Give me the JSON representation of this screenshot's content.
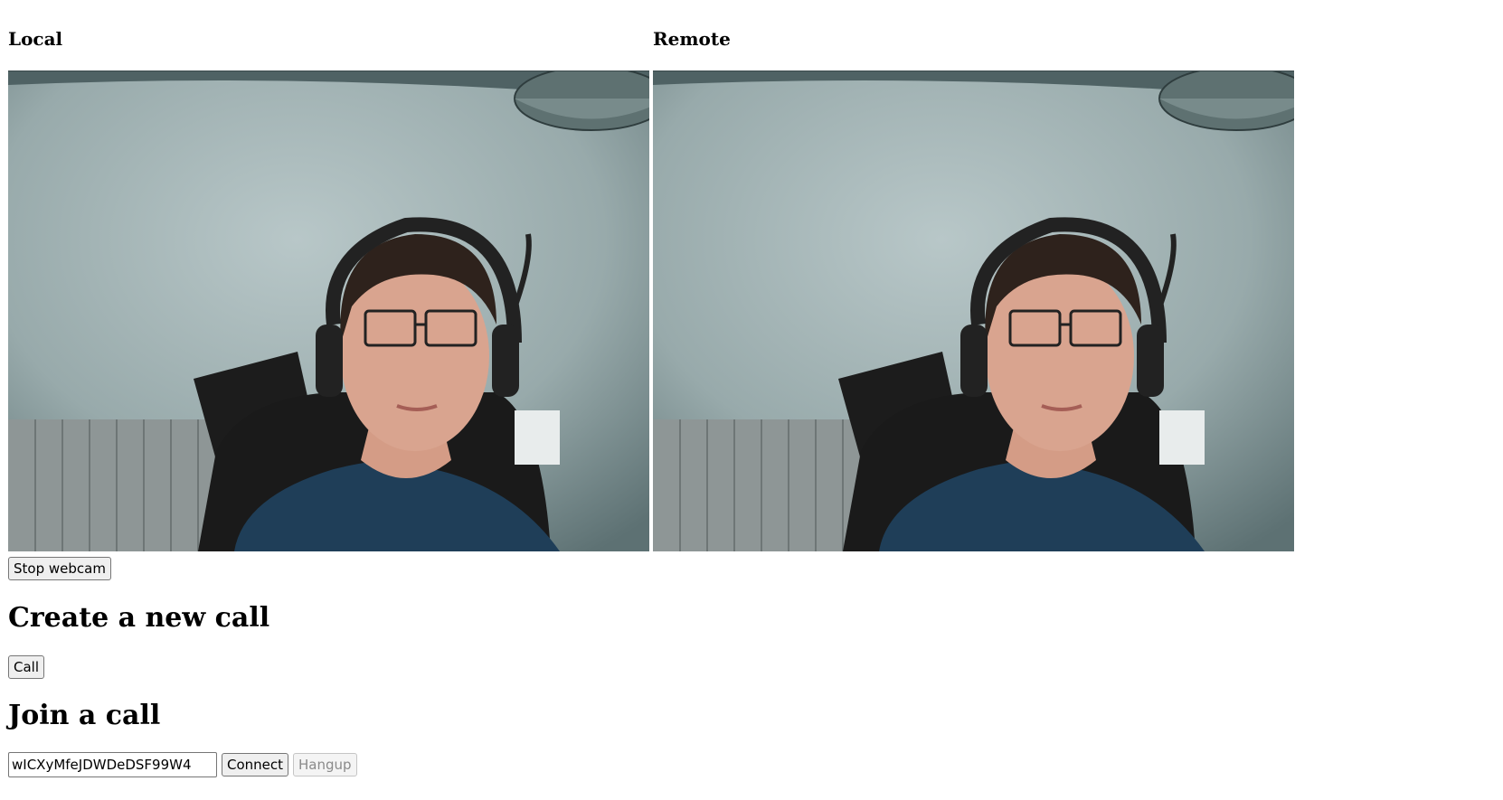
{
  "local": {
    "heading": "Local"
  },
  "remote": {
    "heading": "Remote"
  },
  "controls": {
    "stop_webcam_label": "Stop webcam",
    "create_heading": "Create a new call",
    "call_label": "Call",
    "join_heading": "Join a call",
    "call_id_value": "wICXyMfeJDWDeDSF99W4",
    "connect_label": "Connect",
    "hangup_label": "Hangup"
  },
  "colors": {
    "wall": "#95a8a9",
    "shirt": "#1f3e58",
    "skin": "#d9a48f",
    "hair": "#2e221c",
    "chair": "#1a1a1a"
  }
}
